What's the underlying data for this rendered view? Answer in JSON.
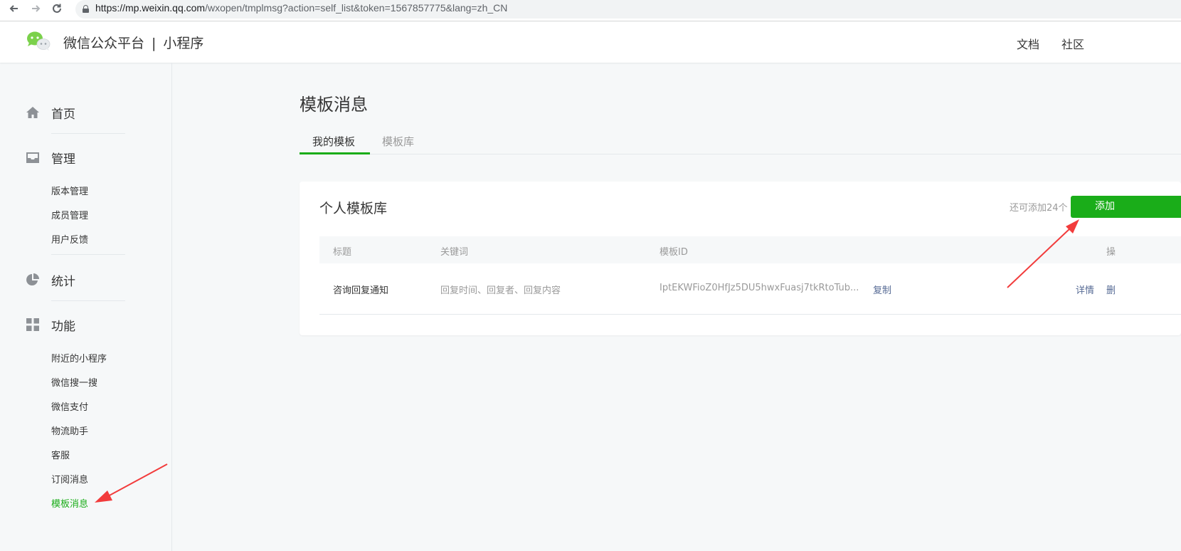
{
  "browser": {
    "url_host": "https://mp.weixin.qq.com",
    "url_path": "/wxopen/tmplmsg?action=self_list&token=1567857775&lang=zh_CN"
  },
  "header": {
    "brand": "微信公众平台",
    "separator": "|",
    "product": "小程序",
    "links": [
      "文档",
      "社区"
    ]
  },
  "sidebar": {
    "home": "首页",
    "manage": "管理",
    "manage_items": [
      "版本管理",
      "成员管理",
      "用户反馈"
    ],
    "stats": "统计",
    "features": "功能",
    "feature_items": [
      "附近的小程序",
      "微信搜一搜",
      "微信支付",
      "物流助手",
      "客服",
      "订阅消息",
      "模板消息"
    ],
    "active_item": "模板消息"
  },
  "main": {
    "title": "模板消息",
    "tabs": [
      "我的模板",
      "模板库"
    ],
    "active_tab": "我的模板",
    "card": {
      "title": "个人模板库",
      "quota": "还可添加24个",
      "add_label": "添加",
      "columns": [
        "标题",
        "关键词",
        "模板ID",
        "操"
      ],
      "rows": [
        {
          "title": "咨询回复通知",
          "keywords": "回复时间、回复者、回复内容",
          "template_id": "IptEKWFioZ0HfJz5DU5hwxFuasj7tkRtoTub...",
          "copy": "复制",
          "detail": "详情",
          "delete": "删"
        }
      ]
    }
  },
  "colors": {
    "accent_green": "#1aad19",
    "link_blue": "#576b95",
    "annotation_red": "#f23c3c"
  }
}
